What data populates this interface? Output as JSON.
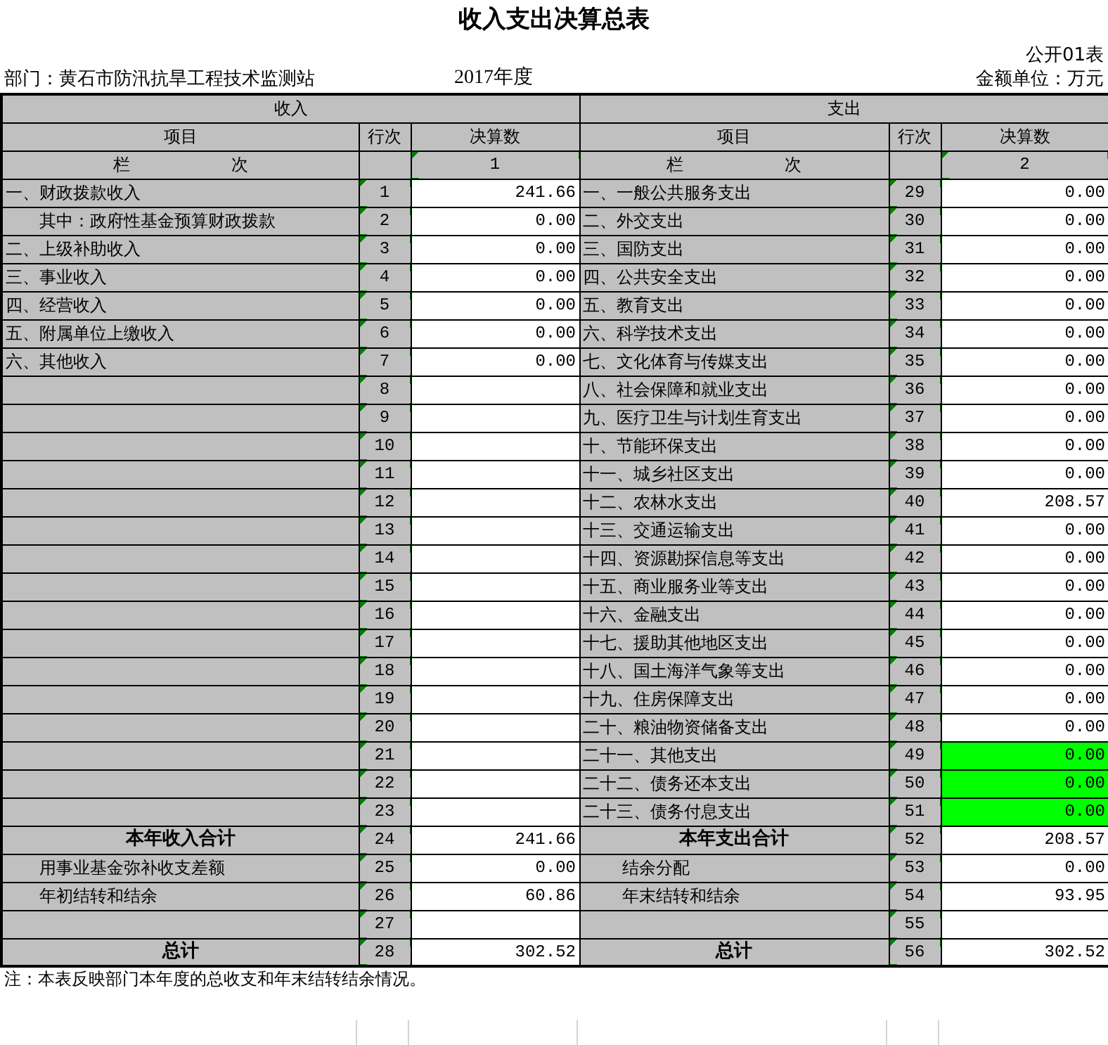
{
  "title": "收入支出决算总表",
  "form_code": "公开01表",
  "department": "部门：黄石市防汛抗旱工程技术监测站",
  "year": "2017年度",
  "unit": "金额单位：万元",
  "income": {
    "heading": "收入",
    "columns": [
      "项目",
      "行次",
      "决算数"
    ],
    "index_label": "栏　　　　　　次",
    "index_value": "1",
    "index_flagged": true
  },
  "expense": {
    "heading": "支出",
    "columns": [
      "项目",
      "行次",
      "决算数"
    ],
    "index_label": "栏　　　　　　次",
    "index_value": "2",
    "index_flagged": true
  },
  "rows": [
    {
      "left": {
        "kind": "normal",
        "label": "一、财政拨款收入",
        "line": "1",
        "value": "241.66",
        "flagged": true
      },
      "right": {
        "kind": "normal",
        "label": "一、一般公共服务支出",
        "line": "29",
        "value": "0.00",
        "flagged": true,
        "highlight": false
      }
    },
    {
      "left": {
        "kind": "indent",
        "label": "其中：政府性基金预算财政拨款",
        "line": "2",
        "value": "0.00",
        "flagged": true
      },
      "right": {
        "kind": "normal",
        "label": "二、外交支出",
        "line": "30",
        "value": "0.00",
        "flagged": true,
        "highlight": false
      }
    },
    {
      "left": {
        "kind": "normal",
        "label": "二、上级补助收入",
        "line": "3",
        "value": "0.00",
        "flagged": true
      },
      "right": {
        "kind": "normal",
        "label": "三、国防支出",
        "line": "31",
        "value": "0.00",
        "flagged": true,
        "highlight": false
      }
    },
    {
      "left": {
        "kind": "normal",
        "label": "三、事业收入",
        "line": "4",
        "value": "0.00",
        "flagged": true
      },
      "right": {
        "kind": "normal",
        "label": "四、公共安全支出",
        "line": "32",
        "value": "0.00",
        "flagged": true,
        "highlight": false
      }
    },
    {
      "left": {
        "kind": "normal",
        "label": "四、经营收入",
        "line": "5",
        "value": "0.00",
        "flagged": true
      },
      "right": {
        "kind": "normal",
        "label": "五、教育支出",
        "line": "33",
        "value": "0.00",
        "flagged": true,
        "highlight": false
      }
    },
    {
      "left": {
        "kind": "normal",
        "label": "五、附属单位上缴收入",
        "line": "6",
        "value": "0.00",
        "flagged": true
      },
      "right": {
        "kind": "normal",
        "label": "六、科学技术支出",
        "line": "34",
        "value": "0.00",
        "flagged": true,
        "highlight": false
      }
    },
    {
      "left": {
        "kind": "normal",
        "label": "六、其他收入",
        "line": "7",
        "value": "0.00",
        "flagged": true
      },
      "right": {
        "kind": "normal",
        "label": "七、文化体育与传媒支出",
        "line": "35",
        "value": "0.00",
        "flagged": true,
        "highlight": false
      }
    },
    {
      "left": {
        "kind": "normal",
        "line": "8",
        "flagged": true
      },
      "right": {
        "kind": "normal",
        "label": "八、社会保障和就业支出",
        "line": "36",
        "value": "0.00",
        "flagged": true,
        "highlight": false
      }
    },
    {
      "left": {
        "kind": "normal",
        "line": "9",
        "flagged": true
      },
      "right": {
        "kind": "normal",
        "label": "九、医疗卫生与计划生育支出",
        "line": "37",
        "value": "0.00",
        "flagged": true,
        "highlight": false
      }
    },
    {
      "left": {
        "kind": "normal",
        "line": "10",
        "flagged": true
      },
      "right": {
        "kind": "normal",
        "label": "十、节能环保支出",
        "line": "38",
        "value": "0.00",
        "flagged": true,
        "highlight": false
      }
    },
    {
      "left": {
        "kind": "normal",
        "line": "11",
        "flagged": true
      },
      "right": {
        "kind": "normal",
        "label": "十一、城乡社区支出",
        "line": "39",
        "value": "0.00",
        "flagged": true,
        "highlight": false
      }
    },
    {
      "left": {
        "kind": "normal",
        "line": "12",
        "flagged": true
      },
      "right": {
        "kind": "normal",
        "label": "十二、农林水支出",
        "line": "40",
        "value": "208.57",
        "flagged": true,
        "highlight": false
      }
    },
    {
      "left": {
        "kind": "normal",
        "line": "13",
        "flagged": true
      },
      "right": {
        "kind": "normal",
        "label": "十三、交通运输支出",
        "line": "41",
        "value": "0.00",
        "flagged": true,
        "highlight": false
      }
    },
    {
      "left": {
        "kind": "normal",
        "line": "14",
        "flagged": true
      },
      "right": {
        "kind": "normal",
        "label": "十四、资源勘探信息等支出",
        "line": "42",
        "value": "0.00",
        "flagged": true,
        "highlight": false
      }
    },
    {
      "left": {
        "kind": "normal",
        "line": "15",
        "flagged": true
      },
      "right": {
        "kind": "normal",
        "label": "十五、商业服务业等支出",
        "line": "43",
        "value": "0.00",
        "flagged": true,
        "highlight": false
      }
    },
    {
      "left": {
        "kind": "normal",
        "line": "16",
        "flagged": true
      },
      "right": {
        "kind": "normal",
        "label": "十六、金融支出",
        "line": "44",
        "value": "0.00",
        "flagged": true,
        "highlight": false
      }
    },
    {
      "left": {
        "kind": "normal",
        "line": "17",
        "flagged": true
      },
      "right": {
        "kind": "normal",
        "label": "十七、援助其他地区支出",
        "line": "45",
        "value": "0.00",
        "flagged": true,
        "highlight": false
      }
    },
    {
      "left": {
        "kind": "normal",
        "line": "18",
        "flagged": true
      },
      "right": {
        "kind": "normal",
        "label": "十八、国土海洋气象等支出",
        "line": "46",
        "value": "0.00",
        "flagged": true,
        "highlight": false
      }
    },
    {
      "left": {
        "kind": "normal",
        "line": "19",
        "flagged": true
      },
      "right": {
        "kind": "normal",
        "label": "十九、住房保障支出",
        "line": "47",
        "value": "0.00",
        "flagged": true,
        "highlight": false
      }
    },
    {
      "left": {
        "kind": "normal",
        "line": "20",
        "flagged": true
      },
      "right": {
        "kind": "normal",
        "label": "二十、粮油物资储备支出",
        "line": "48",
        "value": "0.00",
        "flagged": true,
        "highlight": false
      }
    },
    {
      "left": {
        "kind": "normal",
        "line": "21",
        "flagged": true
      },
      "right": {
        "kind": "normal",
        "label": "二十一、其他支出",
        "line": "49",
        "value": "0.00",
        "flagged": true,
        "highlight": true
      }
    },
    {
      "left": {
        "kind": "normal",
        "line": "22",
        "flagged": true
      },
      "right": {
        "kind": "normal",
        "label": "二十二、债务还本支出",
        "line": "50",
        "value": "0.00",
        "flagged": true,
        "highlight": true
      }
    },
    {
      "left": {
        "kind": "normal",
        "line": "23",
        "flagged": true
      },
      "right": {
        "kind": "normal",
        "label": "二十三、债务付息支出",
        "line": "51",
        "value": "0.00",
        "flagged": true,
        "highlight": true
      }
    },
    {
      "left": {
        "kind": "total",
        "label": "本年收入合计",
        "line": "24",
        "value": "241.66",
        "flagged": true
      },
      "right": {
        "kind": "total",
        "label": "本年支出合计",
        "line": "52",
        "value": "208.57",
        "flagged": true,
        "highlight": false
      }
    },
    {
      "left": {
        "kind": "indent",
        "label": "用事业基金弥补收支差额",
        "line": "25",
        "value": "0.00",
        "flagged": true
      },
      "right": {
        "kind": "deep",
        "label": "结余分配",
        "line": "53",
        "value": "0.00",
        "flagged": true,
        "highlight": false
      }
    },
    {
      "left": {
        "kind": "indent",
        "label": "年初结转和结余",
        "line": "26",
        "value": "60.86",
        "flagged": true
      },
      "right": {
        "kind": "deep",
        "label": "年末结转和结余",
        "line": "54",
        "value": "93.95",
        "flagged": true,
        "highlight": false
      }
    },
    {
      "left": {
        "kind": "normal",
        "line": "27",
        "flagged": true
      },
      "right": {
        "kind": "normal",
        "line": "55",
        "flagged": true,
        "highlight": false
      }
    },
    {
      "left": {
        "kind": "total",
        "label": "总计",
        "line": "28",
        "value": "302.52",
        "flagged": true
      },
      "right": {
        "kind": "total",
        "label": "总计",
        "line": "56",
        "value": "302.52",
        "flagged": true,
        "highlight": false
      }
    }
  ],
  "note": "注：本表反映部门本年度的总收支和年末结转结余情况。"
}
